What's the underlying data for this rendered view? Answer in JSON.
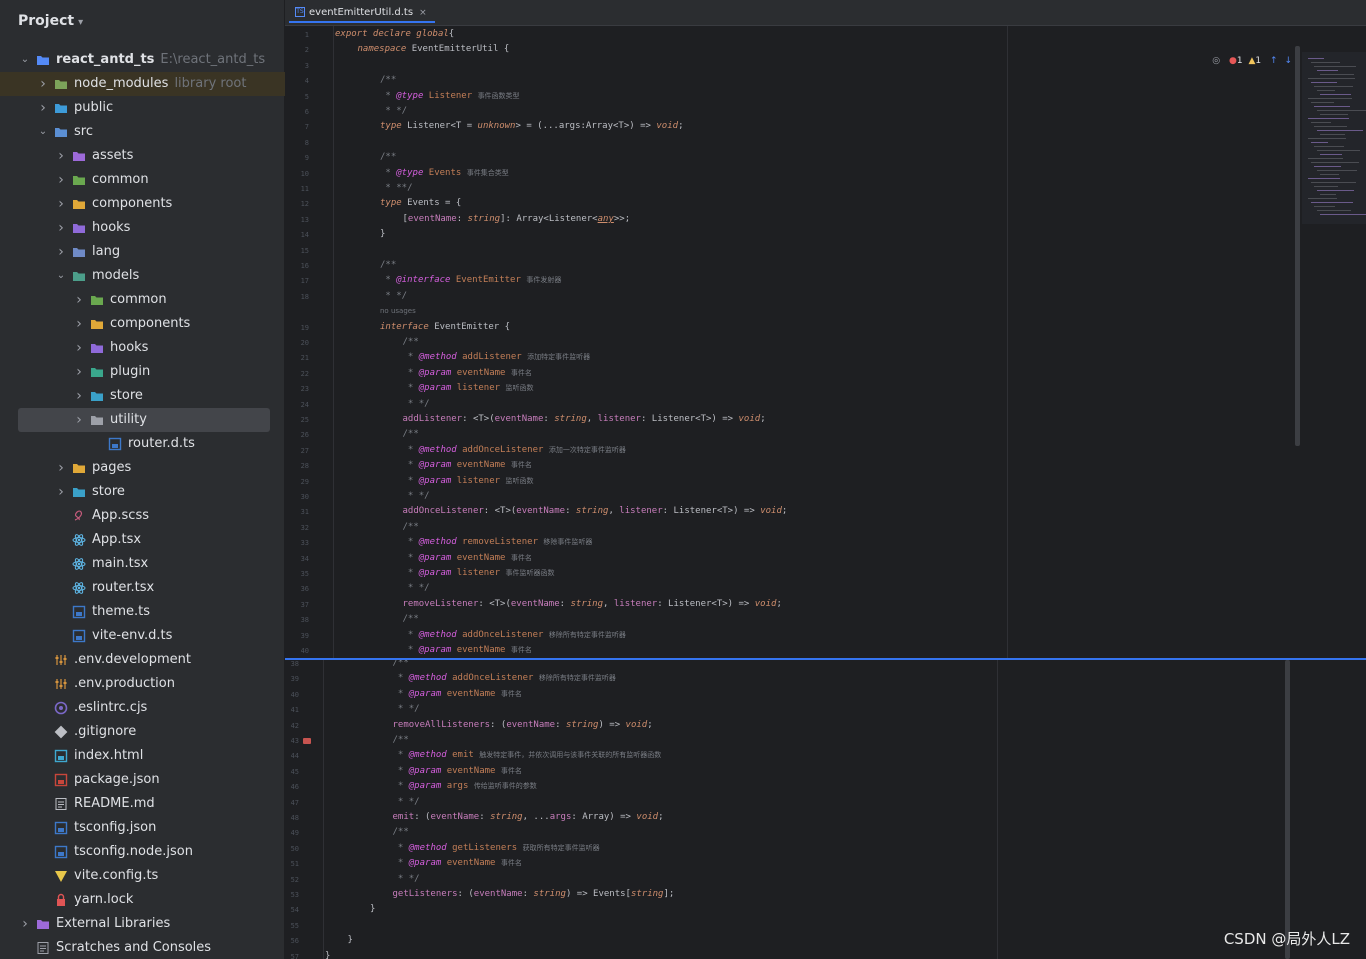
{
  "project": {
    "title": "Project"
  },
  "tree": [
    {
      "label": "react_antd_ts",
      "sub": "E:\\react_antd_ts",
      "depth": 0,
      "open": true,
      "icon": "module-folder-icon",
      "color": "#548af7",
      "bold": true
    },
    {
      "label": "node_modules",
      "sub": "library root",
      "depth": 1,
      "open": false,
      "icon": "folder-icon",
      "color": "#7ca35a",
      "hl": true
    },
    {
      "label": "public",
      "depth": 1,
      "open": false,
      "icon": "folder-icon",
      "color": "#3d9bd9"
    },
    {
      "label": "src",
      "depth": 1,
      "open": true,
      "icon": "source-folder-icon",
      "color": "#5b8fd4"
    },
    {
      "label": "assets",
      "depth": 2,
      "open": false,
      "icon": "folder-icon",
      "color": "#9d6ad9"
    },
    {
      "label": "common",
      "depth": 2,
      "open": false,
      "icon": "folder-icon",
      "color": "#6aa84f"
    },
    {
      "label": "components",
      "depth": 2,
      "open": false,
      "icon": "folder-icon",
      "color": "#e0a838"
    },
    {
      "label": "hooks",
      "depth": 2,
      "open": false,
      "icon": "folder-icon",
      "color": "#8f6ad9"
    },
    {
      "label": "lang",
      "depth": 2,
      "open": false,
      "icon": "folder-icon",
      "color": "#6f8ac6"
    },
    {
      "label": "models",
      "depth": 2,
      "open": true,
      "icon": "folder-icon",
      "color": "#4c9e8a"
    },
    {
      "label": "common",
      "depth": 3,
      "open": false,
      "icon": "folder-icon",
      "color": "#6aa84f"
    },
    {
      "label": "components",
      "depth": 3,
      "open": false,
      "icon": "folder-icon",
      "color": "#e0a838"
    },
    {
      "label": "hooks",
      "depth": 3,
      "open": false,
      "icon": "folder-icon",
      "color": "#8f6ad9"
    },
    {
      "label": "plugin",
      "depth": 3,
      "open": false,
      "icon": "folder-icon",
      "color": "#3aa78c"
    },
    {
      "label": "store",
      "depth": 3,
      "open": false,
      "icon": "folder-icon",
      "color": "#3aa0c8"
    },
    {
      "label": "utility",
      "depth": 3,
      "open": false,
      "icon": "folder-icon",
      "color": "#9da0a8",
      "sel": true
    },
    {
      "label": "router.d.ts",
      "depth": 4,
      "icon": "ts-file-icon",
      "color": "#3d78c9",
      "leaf": true
    },
    {
      "label": "pages",
      "depth": 2,
      "open": false,
      "icon": "folder-icon",
      "color": "#e0a838"
    },
    {
      "label": "store",
      "depth": 2,
      "open": false,
      "icon": "folder-icon",
      "color": "#3aa0c8"
    },
    {
      "label": "App.scss",
      "depth": 2,
      "icon": "scss-file-icon",
      "color": "#c65b7c",
      "leaf": true
    },
    {
      "label": "App.tsx",
      "depth": 2,
      "icon": "react-file-icon",
      "color": "#5fb8e8",
      "leaf": true
    },
    {
      "label": "main.tsx",
      "depth": 2,
      "icon": "react-file-icon",
      "color": "#5fb8e8",
      "leaf": true
    },
    {
      "label": "router.tsx",
      "depth": 2,
      "icon": "react-file-icon",
      "color": "#5fb8e8",
      "leaf": true
    },
    {
      "label": "theme.ts",
      "depth": 2,
      "icon": "ts-file-icon",
      "color": "#3d78c9",
      "leaf": true
    },
    {
      "label": "vite-env.d.ts",
      "depth": 2,
      "icon": "ts-file-icon",
      "color": "#3d78c9",
      "leaf": true
    },
    {
      "label": ".env.development",
      "depth": 1,
      "icon": "env-file-icon",
      "color": "#d5943e",
      "leaf": true
    },
    {
      "label": ".env.production",
      "depth": 1,
      "icon": "env-file-icon",
      "color": "#d5943e",
      "leaf": true
    },
    {
      "label": ".eslintrc.cjs",
      "depth": 1,
      "icon": "eslint-file-icon",
      "color": "#7b68c8",
      "leaf": true
    },
    {
      "label": ".gitignore",
      "depth": 1,
      "icon": "git-file-icon",
      "color": "#bcbec4",
      "leaf": true
    },
    {
      "label": "index.html",
      "depth": 1,
      "icon": "html-file-icon",
      "color": "#3fa8d0",
      "leaf": true
    },
    {
      "label": "package.json",
      "depth": 1,
      "icon": "npm-file-icon",
      "color": "#c8463b",
      "leaf": true
    },
    {
      "label": "README.md",
      "depth": 1,
      "icon": "markdown-file-icon",
      "color": "#bcbec4",
      "leaf": true
    },
    {
      "label": "tsconfig.json",
      "depth": 1,
      "icon": "tsconfig-file-icon",
      "color": "#3d78c9",
      "leaf": true
    },
    {
      "label": "tsconfig.node.json",
      "depth": 1,
      "icon": "tsconfig-file-icon",
      "color": "#3d78c9",
      "leaf": true
    },
    {
      "label": "vite.config.ts",
      "depth": 1,
      "icon": "vite-file-icon",
      "color": "#e8c74a",
      "leaf": true
    },
    {
      "label": "yarn.lock",
      "depth": 1,
      "icon": "lock-file-icon",
      "color": "#e05555",
      "leaf": true
    },
    {
      "label": "External Libraries",
      "depth": 0,
      "open": false,
      "icon": "library-icon",
      "color": "#9d6ad9"
    },
    {
      "label": "Scratches and Consoles",
      "depth": 0,
      "icon": "scratches-icon",
      "color": "#9da0a8",
      "leaf": true
    }
  ],
  "editor": {
    "tab": "eventEmitterUtil.d.ts",
    "tab_close": "×",
    "inspection": {
      "errors": "1",
      "warnings": "1"
    },
    "top": [
      {
        "n": "1",
        "i": 0,
        "h": "<span class='kw'>export declare global</span>{"
      },
      {
        "n": "2",
        "i": 1,
        "h": "<span class='kw'>namespace</span> EventEmitterUtil {"
      },
      {
        "n": "3",
        "i": 0,
        "h": ""
      },
      {
        "n": "4",
        "i": 2,
        "h": "<span class='cm'>/**</span>"
      },
      {
        "n": "5",
        "i": 2,
        "h": "<span class='cm'> * </span><span class='tag'>@type</span> <span class='tg2'>Listener</span> <span class='cn'>事件函数类型</span>"
      },
      {
        "n": "6",
        "i": 2,
        "h": "<span class='cm'> * */</span>"
      },
      {
        "n": "7",
        "i": 2,
        "h": "<span class='kw'>type</span> Listener&lt;T = <span class='kw'>unknown</span>&gt; = (...args:Array&lt;T&gt;) =&gt; <span class='kw'>void</span>;"
      },
      {
        "n": "8",
        "i": 0,
        "h": ""
      },
      {
        "n": "9",
        "i": 2,
        "h": "<span class='cm'>/**</span>"
      },
      {
        "n": "10",
        "i": 2,
        "h": "<span class='cm'> * </span><span class='tag'>@type</span> <span class='tg2'>Events</span> <span class='cn'>事件集合类型</span>"
      },
      {
        "n": "11",
        "i": 2,
        "h": "<span class='cm'> * **/</span>"
      },
      {
        "n": "12",
        "i": 2,
        "h": "<span class='kw'>type</span> Events = {"
      },
      {
        "n": "13",
        "i": 3,
        "h": "[<span class='nm'>eventName</span>: <span class='kw'>string</span>]: Array&lt;Listener&lt;<span class='kw' style='text-decoration:underline'>any</span>&gt;&gt;;"
      },
      {
        "n": "14",
        "i": 2,
        "h": "}"
      },
      {
        "n": "15",
        "i": 0,
        "h": ""
      },
      {
        "n": "16",
        "i": 2,
        "h": "<span class='cm'>/**</span>"
      },
      {
        "n": "17",
        "i": 2,
        "h": "<span class='cm'> * </span><span class='tag'>@interface</span> <span class='tg2'>EventEmitter</span> <span class='cn'>事件发射器</span>"
      },
      {
        "n": "18",
        "i": 2,
        "h": "<span class='cm'> * */</span>"
      },
      {
        "n": "",
        "i": 2,
        "h": "<span class='cn' style='color:#6f737a'>no usages</span>"
      },
      {
        "n": "19",
        "i": 2,
        "h": "<span class='kw'>interface</span> EventEmitter {"
      },
      {
        "n": "20",
        "i": 3,
        "h": "<span class='cm'>/**</span>"
      },
      {
        "n": "21",
        "i": 3,
        "h": "<span class='cm'> * </span><span class='tag'>@method</span> <span class='tg2'>addListener</span> <span class='cn'>添加特定事件监听器</span>"
      },
      {
        "n": "22",
        "i": 3,
        "h": "<span class='cm'> * </span><span class='tag'>@param</span> <span class='tg2'>eventName</span> <span class='cn'>事件名</span>"
      },
      {
        "n": "23",
        "i": 3,
        "h": "<span class='cm'> * </span><span class='tag'>@param</span> <span class='tg2'>listener</span> <span class='cn'>监听函数</span>"
      },
      {
        "n": "24",
        "i": 3,
        "h": "<span class='cm'> * */</span>"
      },
      {
        "n": "25",
        "i": 3,
        "h": "<span class='nm'>addListener</span>: &lt;T&gt;(<span class='nm'>eventName</span>: <span class='kw'>string</span>, <span class='nm'>listener</span>: Listener&lt;T&gt;) =&gt; <span class='kw'>void</span>;"
      },
      {
        "n": "26",
        "i": 3,
        "h": "<span class='cm'>/**</span>"
      },
      {
        "n": "27",
        "i": 3,
        "h": "<span class='cm'> * </span><span class='tag'>@method</span> <span class='tg2'>addOnceListener</span> <span class='cn'>添加一次特定事件监听器</span>"
      },
      {
        "n": "28",
        "i": 3,
        "h": "<span class='cm'> * </span><span class='tag'>@param</span> <span class='tg2'>eventName</span> <span class='cn'>事件名</span>"
      },
      {
        "n": "29",
        "i": 3,
        "h": "<span class='cm'> * </span><span class='tag'>@param</span> <span class='tg2'>listener</span> <span class='cn'>监听函数</span>"
      },
      {
        "n": "30",
        "i": 3,
        "h": "<span class='cm'> * */</span>"
      },
      {
        "n": "31",
        "i": 3,
        "h": "<span class='nm'>addOnceListener</span>: &lt;T&gt;(<span class='nm'>eventName</span>: <span class='kw'>string</span>, <span class='nm'>listener</span>: Listener&lt;T&gt;) =&gt; <span class='kw'>void</span>;"
      },
      {
        "n": "32",
        "i": 3,
        "h": "<span class='cm'>/**</span>"
      },
      {
        "n": "33",
        "i": 3,
        "h": "<span class='cm'> * </span><span class='tag'>@method</span> <span class='tg2'>removeListener</span> <span class='cn'>移除事件监听器</span>"
      },
      {
        "n": "34",
        "i": 3,
        "h": "<span class='cm'> * </span><span class='tag'>@param</span> <span class='tg2'>eventName</span> <span class='cn'>事件名</span>"
      },
      {
        "n": "35",
        "i": 3,
        "h": "<span class='cm'> * </span><span class='tag'>@param</span> <span class='tg2'>listener</span> <span class='cn'>事件监听器函数</span>"
      },
      {
        "n": "36",
        "i": 3,
        "h": "<span class='cm'> * */</span>"
      },
      {
        "n": "37",
        "i": 3,
        "h": "<span class='nm'>removeListener</span>: &lt;T&gt;(<span class='nm'>eventName</span>: <span class='kw'>string</span>, <span class='nm'>listener</span>: Listener&lt;T&gt;) =&gt; <span class='kw'>void</span>;"
      },
      {
        "n": "38",
        "i": 3,
        "h": "<span class='cm'>/**</span>"
      },
      {
        "n": "39",
        "i": 3,
        "h": "<span class='cm'> * </span><span class='tag'>@method</span> <span class='tg2'>addOnceListener</span> <span class='cn'>移除所有特定事件监听器</span>"
      },
      {
        "n": "40",
        "i": 3,
        "h": "<span class='cm'> * </span><span class='tag'>@param</span> <span class='tg2'>eventName</span> <span class='cn'>事件名</span>"
      }
    ],
    "bottom": [
      {
        "n": "38",
        "i": 3,
        "h": "<span class='cm'>/**</span>"
      },
      {
        "n": "39",
        "i": 3,
        "h": "<span class='cm'> * </span><span class='tag'>@method</span> <span class='tg2'>addOnceListener</span> <span class='cn'>移除所有特定事件监听器</span>"
      },
      {
        "n": "40",
        "i": 3,
        "h": "<span class='cm'> * </span><span class='tag'>@param</span> <span class='tg2'>eventName</span> <span class='cn'>事件名</span>"
      },
      {
        "n": "41",
        "i": 3,
        "h": "<span class='cm'> * */</span>"
      },
      {
        "n": "42",
        "i": 3,
        "h": "<span class='nm'>removeAllListeners</span>: (<span class='nm'>eventName</span>: <span class='kw'>string</span>) =&gt; <span class='kw'>void</span>;"
      },
      {
        "n": "43",
        "i": 3,
        "h": "<span class='cm'>/**</span>"
      },
      {
        "n": "44",
        "i": 3,
        "h": "<span class='cm'> * </span><span class='tag'>@method</span> <span class='tg2'>emit</span> <span class='cn'>触发特定事件，并依次调用与该事件关联的所有监听器函数</span>"
      },
      {
        "n": "45",
        "i": 3,
        "h": "<span class='cm'> * </span><span class='tag'>@param</span> <span class='tg2'>eventName</span> <span class='cn'>事件名</span>"
      },
      {
        "n": "46",
        "i": 3,
        "h": "<span class='cm'> * </span><span class='tag'>@param</span> <span class='tg2'>args</span> <span class='cn'>传给监听事件的参数</span>"
      },
      {
        "n": "47",
        "i": 3,
        "h": "<span class='cm'> * */</span>"
      },
      {
        "n": "48",
        "i": 3,
        "h": "<span class='nm'>emit</span>: (<span class='nm'>eventName</span>: <span class='kw'>string</span>, ...<span class='nm'>args</span>: Array) =&gt; <span class='kw'>void</span>;"
      },
      {
        "n": "49",
        "i": 3,
        "h": "<span class='cm'>/**</span>"
      },
      {
        "n": "50",
        "i": 3,
        "h": "<span class='cm'> * </span><span class='tag'>@method</span> <span class='tg2'>getListeners</span> <span class='cn'>获取所有特定事件监听器</span>"
      },
      {
        "n": "51",
        "i": 3,
        "h": "<span class='cm'> * </span><span class='tag'>@param</span> <span class='tg2'>eventName</span> <span class='cn'>事件名</span>"
      },
      {
        "n": "52",
        "i": 3,
        "h": "<span class='cm'> * */</span>"
      },
      {
        "n": "53",
        "i": 3,
        "h": "<span class='nm'>getListeners</span>: (<span class='nm'>eventName</span>: <span class='kw'>string</span>) =&gt; Events[<span class='kw'>string</span>];"
      },
      {
        "n": "54",
        "i": 2,
        "h": "}"
      },
      {
        "n": "55",
        "i": 0,
        "h": ""
      },
      {
        "n": "56",
        "i": 1,
        "h": "}"
      },
      {
        "n": "57",
        "i": 0,
        "h": "}"
      }
    ]
  },
  "watermark": "CSDN @局外人LZ"
}
